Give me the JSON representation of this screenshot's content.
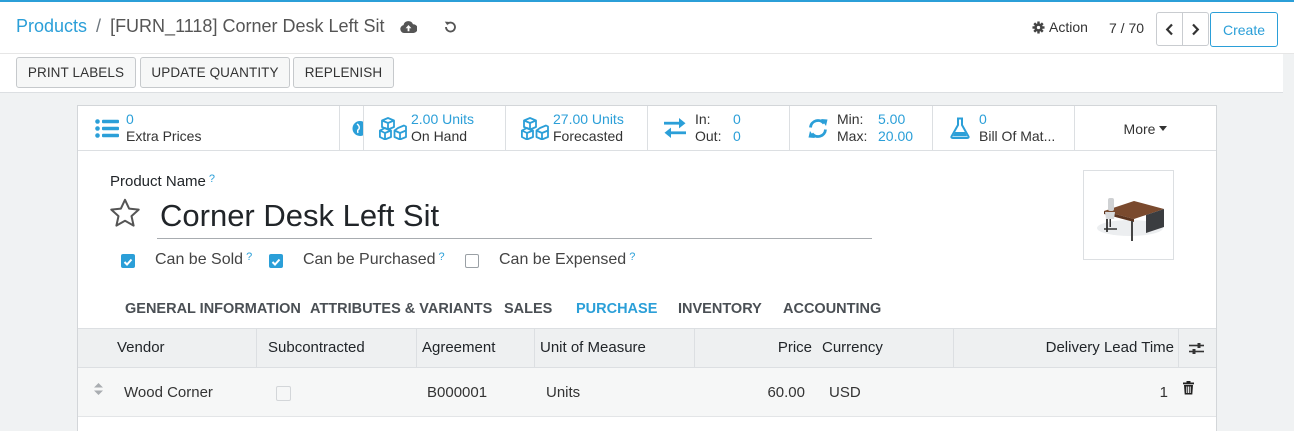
{
  "header": {
    "breadcrumb_root": "Products",
    "breadcrumb_separator": "/",
    "breadcrumb_current": "[FURN_1118] Corner Desk Left Sit",
    "action_label": "Action",
    "pager_value": "7 / 70",
    "create_label": "Create"
  },
  "toolbar": {
    "print_labels": "PRINT LABELS",
    "update_quantity": "UPDATE QUANTITY",
    "replenish": "REPLENISH"
  },
  "smart_buttons": {
    "extra_prices": {
      "value": "0",
      "label": "Extra Prices"
    },
    "on_hand": {
      "value": "2.00 Units",
      "label": "On Hand"
    },
    "forecasted": {
      "value": "27.00 Units",
      "label": "Forecasted"
    },
    "in_out": {
      "in_label": "In:",
      "in_value": "0",
      "out_label": "Out:",
      "out_value": "0"
    },
    "min_max": {
      "min_label": "Min:",
      "min_value": "5.00",
      "max_label": "Max:",
      "max_value": "20.00"
    },
    "bom": {
      "value": "0",
      "label": "Bill Of Mat..."
    },
    "more_label": "More"
  },
  "form": {
    "product_name_label": "Product Name",
    "help_mark": "?",
    "product_name": "Corner Desk Left Sit",
    "options": [
      {
        "label": "Can be Sold",
        "checked": true
      },
      {
        "label": "Can be Purchased",
        "checked": true
      },
      {
        "label": "Can be Expensed",
        "checked": false
      }
    ]
  },
  "tabs": [
    "GENERAL INFORMATION",
    "ATTRIBUTES & VARIANTS",
    "SALES",
    "PURCHASE",
    "INVENTORY",
    "ACCOUNTING"
  ],
  "active_tab": "PURCHASE",
  "vendor_table": {
    "columns": [
      "Vendor",
      "Subcontracted",
      "Agreement",
      "Unit of Measure",
      "Price",
      "Currency",
      "Delivery Lead Time"
    ],
    "rows": [
      {
        "vendor": "Wood Corner",
        "subcontracted": false,
        "agreement": "B000001",
        "uom": "Units",
        "price": "60.00",
        "currency": "USD",
        "lead_time": "1"
      }
    ]
  },
  "colors": {
    "accent": "#2b9fd8",
    "text": "#212529",
    "header_bg": "#eef0f1"
  },
  "icons": [
    "cloud-upload-icon",
    "discard-icon",
    "gear-icon",
    "chevron-left-icon",
    "chevron-right-icon",
    "list-icon",
    "globe-icon",
    "cubes-icon",
    "exchange-icon",
    "refresh-icon",
    "flask-icon",
    "caret-down-icon",
    "star-icon",
    "drag-handle-icon",
    "trash-icon",
    "column-settings-icon"
  ]
}
